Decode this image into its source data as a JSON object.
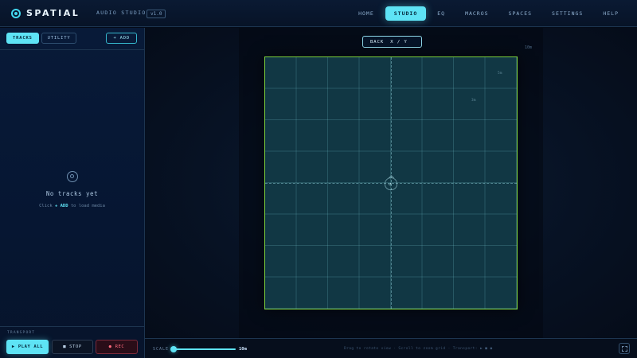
{
  "header": {
    "brand": "SPATIAL",
    "subtitle": "AUDIO STUDIO",
    "version": "v1.0",
    "nav": [
      "HOME",
      "STUDIO",
      "EQ",
      "MACROS",
      "SPACES",
      "SETTINGS",
      "HELP"
    ],
    "active_nav": "STUDIO"
  },
  "sidebar": {
    "tabs": [
      "TRACKS",
      "UTILITY"
    ],
    "add_label": "+ ADD",
    "empty": {
      "title": "No tracks yet",
      "hint_before": "Click ",
      "hint_key": "+ ADD",
      "hint_after": " to load media"
    },
    "transport": {
      "label": "TRANSPORT",
      "play": "PLAY ALL",
      "stop": "STOP",
      "rec": "REC",
      "play_icon": "▶",
      "stop_icon": "■",
      "rec_icon": "●"
    }
  },
  "stage": {
    "view_left": "BACK",
    "view_right": "X / Y",
    "zoom_readout": "10m",
    "corner_labels": [
      "5m",
      "3m"
    ],
    "listener_glyph": "↺"
  },
  "footer": {
    "scale_label": "SCALE",
    "scale_value": "10",
    "scale_unit": "m",
    "scale_fraction": 0.0,
    "hints": "Drag to rotate view · Scroll to zoom grid · Transport: ▶ ■ ●"
  },
  "colors": {
    "accent": "#5ee3f5",
    "grid_border": "#7dd23f",
    "rec": "#ff6b7d"
  }
}
